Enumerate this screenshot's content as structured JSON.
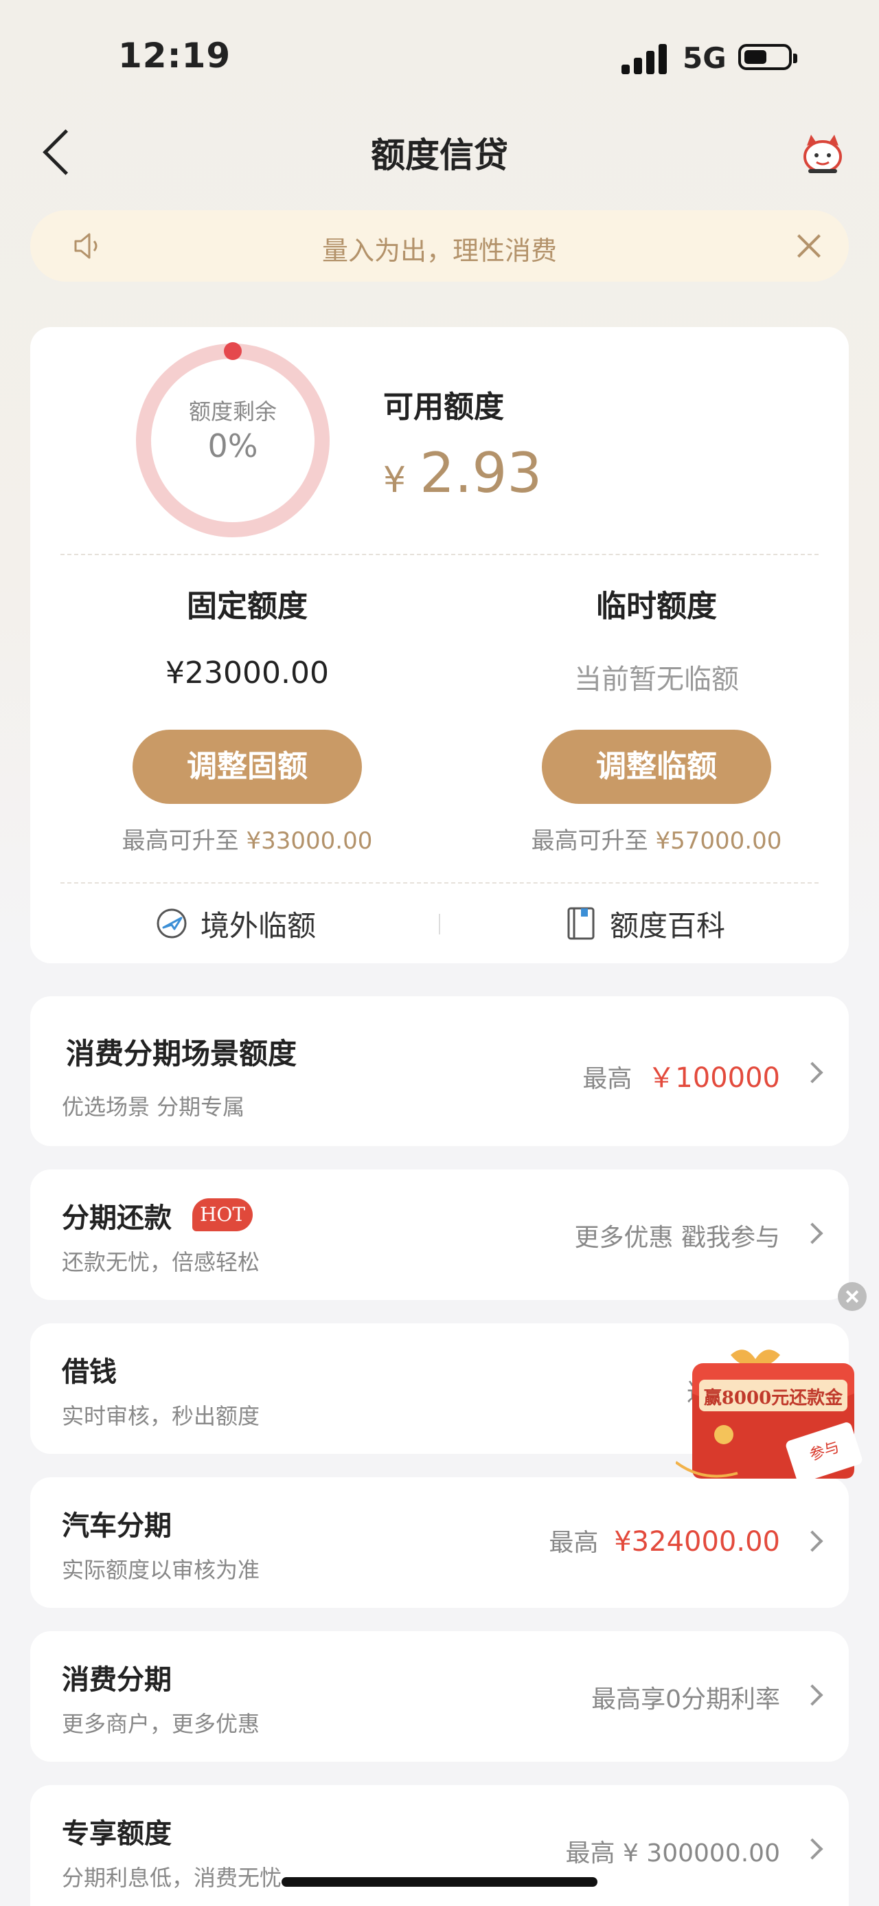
{
  "status_bar": {
    "time": "12:19",
    "network": "5G"
  },
  "nav": {
    "title": "额度信贷"
  },
  "notice": {
    "text": "量入为出，理性消费"
  },
  "quota": {
    "ring_label": "额度剩余",
    "remaining_percent": "0%",
    "available_label": "可用额度",
    "currency": "¥",
    "available_value": "2.93",
    "fixed": {
      "title": "固定额度",
      "value": "¥23000.00",
      "button": "调整固额",
      "note_prefix": "最高可升至",
      "note_amount": "¥33000.00"
    },
    "temp": {
      "title": "临时额度",
      "value": "当前暂无临额",
      "button": "调整临额",
      "note_prefix": "最高可升至",
      "note_amount": "¥57000.00"
    },
    "links": [
      "境外临额",
      "额度百科"
    ]
  },
  "rows": [
    {
      "title": "消费分期场景额度",
      "subtitle": "优选场景 分期专属",
      "right_prefix": "最高",
      "right_red": "￥100000"
    },
    {
      "title": "分期还款",
      "badge": "HOT",
      "subtitle": "还款无忧，倍感轻松",
      "right": "更多优惠 戳我参与"
    },
    {
      "title": "借钱",
      "subtitle": "实时审核，秒出额度",
      "right": "达"
    },
    {
      "title": "汽车分期",
      "subtitle": "实际额度以审核为准",
      "right_prefix": "最高",
      "right_red": "¥324000.00"
    },
    {
      "title": "消费分期",
      "subtitle": "更多商户，更多优惠",
      "right": "最高享0分期利率"
    },
    {
      "title": "专享额度",
      "subtitle": "分期利息低，消费无忧",
      "right": "最高 ¥ 300000.00"
    }
  ],
  "promo": {
    "text": "赢8000元还款金",
    "stamp": "参与"
  },
  "colors": {
    "gold": "#c99a66",
    "gold_text": "#b3926a",
    "red": "#e34a3c",
    "ring": "#f5cfcf",
    "ring_dot": "#e5484d"
  }
}
